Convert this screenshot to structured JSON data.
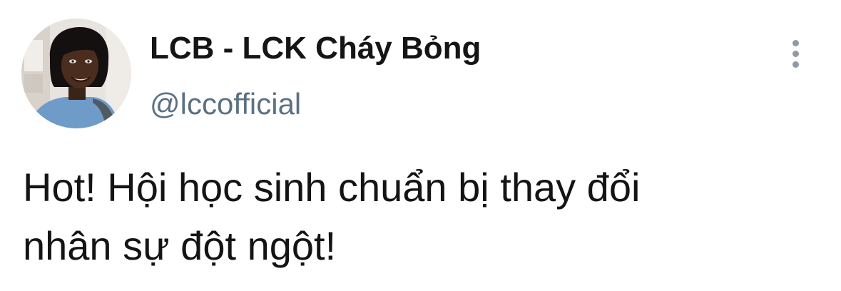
{
  "tweet": {
    "author": {
      "display_name": "LCB - LCK Cháy Bỏng",
      "handle": "@lccofficial",
      "avatar_icon": "profile-photo"
    },
    "more_icon": "vertical-ellipsis-icon",
    "text": "Hot! Hội học sinh chuẩn bị thay đổi\nnhân sự đột ngột!"
  },
  "colors": {
    "background": "#ffffff",
    "name_text": "#151515",
    "handle_text": "#5b7083",
    "more_icon": "#8f9aa6"
  }
}
